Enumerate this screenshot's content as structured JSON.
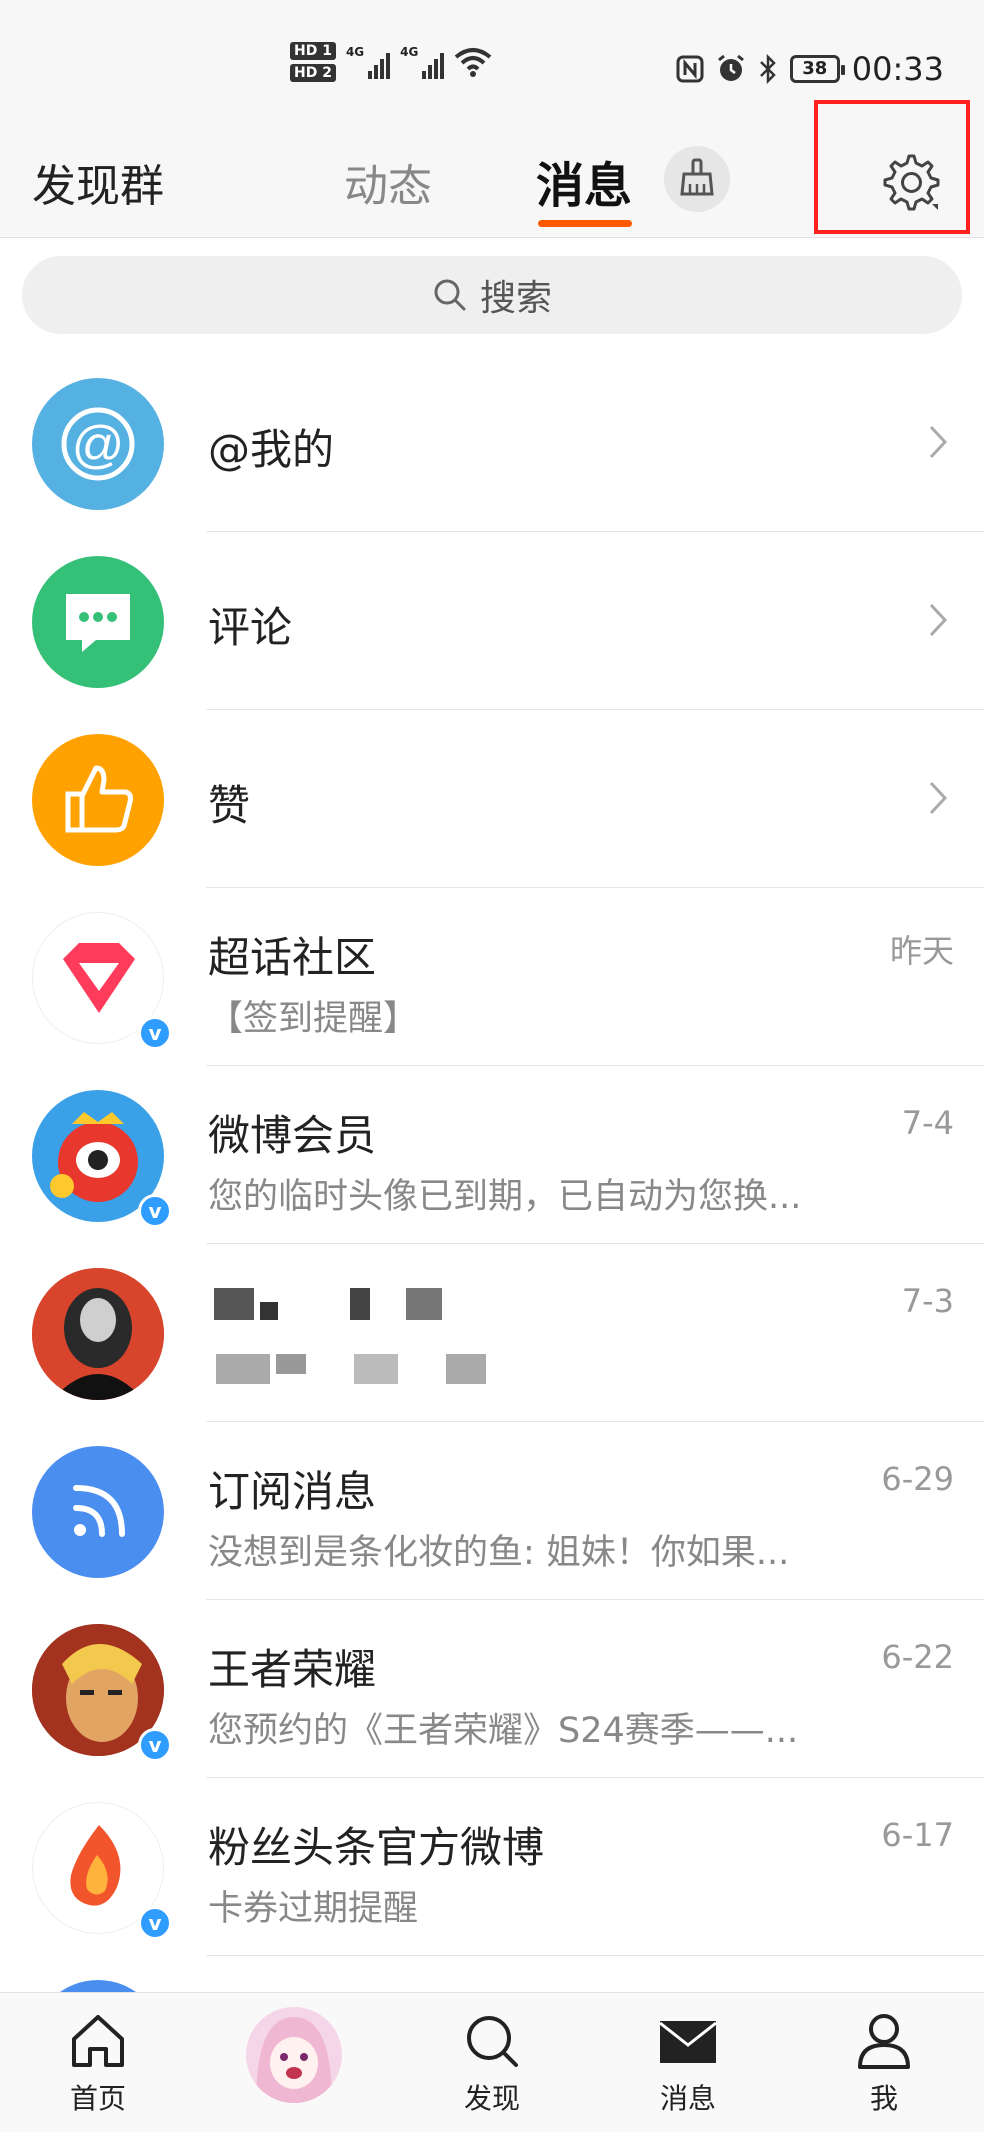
{
  "status_bar": {
    "hd1": "HD 1",
    "hd2": "HD 2",
    "network1": "4G",
    "network2": "4G",
    "battery": "38",
    "time": "00:33"
  },
  "header": {
    "left_label": "发现群",
    "tabs": [
      {
        "label": "动态",
        "active": false
      },
      {
        "label": "消息",
        "active": true
      }
    ]
  },
  "search": {
    "placeholder": "搜索"
  },
  "shortcut_rows": [
    {
      "label": "@我的",
      "icon": "at-icon",
      "color": "#56b1e3"
    },
    {
      "label": "评论",
      "icon": "comment-icon",
      "color": "#34c076"
    },
    {
      "label": "赞",
      "icon": "thumbs-up-icon",
      "color": "#ffa200"
    }
  ],
  "messages": [
    {
      "name": "超话社区",
      "preview": "【签到提醒】",
      "time": "昨天",
      "verified": true
    },
    {
      "name": "微博会员",
      "preview": "您的临时头像已到期，已自动为您换...",
      "time": "7-4",
      "verified": true
    },
    {
      "name": "",
      "preview": "",
      "time": "7-3",
      "verified": false
    },
    {
      "name": "订阅消息",
      "preview": "没想到是条化妆的鱼: 姐妹！你如果...",
      "time": "6-29",
      "verified": false
    },
    {
      "name": "王者荣耀",
      "preview": "您预约的《王者荣耀》S24赛季——...",
      "time": "6-22",
      "verified": true
    },
    {
      "name": "粉丝头条官方微博",
      "preview": "卡券过期提醒",
      "time": "6-17",
      "verified": true
    }
  ],
  "bottom_nav": [
    {
      "label": "首页",
      "icon": "home-icon"
    },
    {
      "label": "",
      "icon": "avatar"
    },
    {
      "label": "发现",
      "icon": "search-icon"
    },
    {
      "label": "消息",
      "icon": "mail-icon"
    },
    {
      "label": "我",
      "icon": "profile-icon"
    }
  ],
  "colors": {
    "accent": "#ff5a00",
    "highlight_box": "#ff2020",
    "verified": "#2f9dff"
  }
}
